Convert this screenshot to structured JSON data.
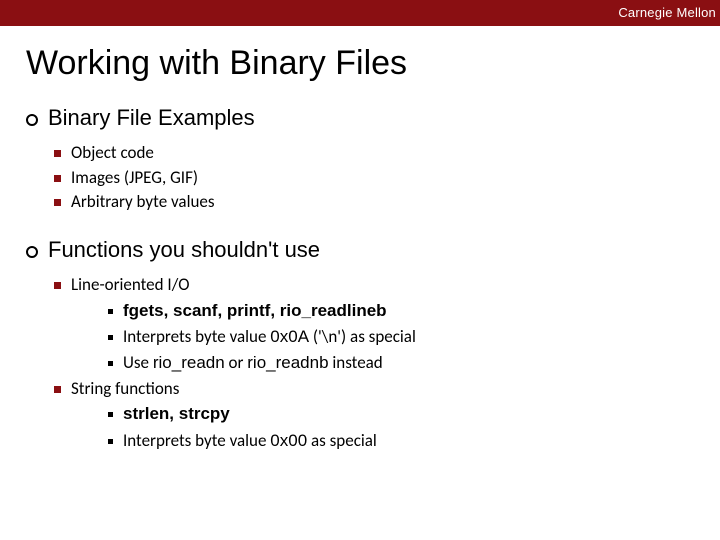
{
  "header": {
    "brand": "Carnegie Mellon"
  },
  "title": "Working with Binary Files",
  "sections": [
    {
      "heading": "Binary File Examples",
      "items": [
        {
          "text": "Object code"
        },
        {
          "text": "Images (JPEG, GIF)"
        },
        {
          "text": "Arbitrary byte values"
        }
      ]
    },
    {
      "heading": "Functions you shouldn't use",
      "items": [
        {
          "text": "Line-oriented I/O",
          "sub": [
            {
              "bold": "fgets, scanf, printf, rio_readlineb"
            },
            {
              "pre": "Interprets byte value ",
              "code": "0x0A",
              "post": " ('\\n') as special"
            },
            {
              "pre": "Use ",
              "code": "rio_readn",
              "mid": " or ",
              "code2": "rio_readnb",
              "post": " instead"
            }
          ]
        },
        {
          "text": "String functions",
          "sub": [
            {
              "bold": "strlen, strcpy"
            },
            {
              "pre": "Interprets byte value ",
              "code": "0x00",
              "post": " as special"
            }
          ]
        }
      ]
    }
  ]
}
